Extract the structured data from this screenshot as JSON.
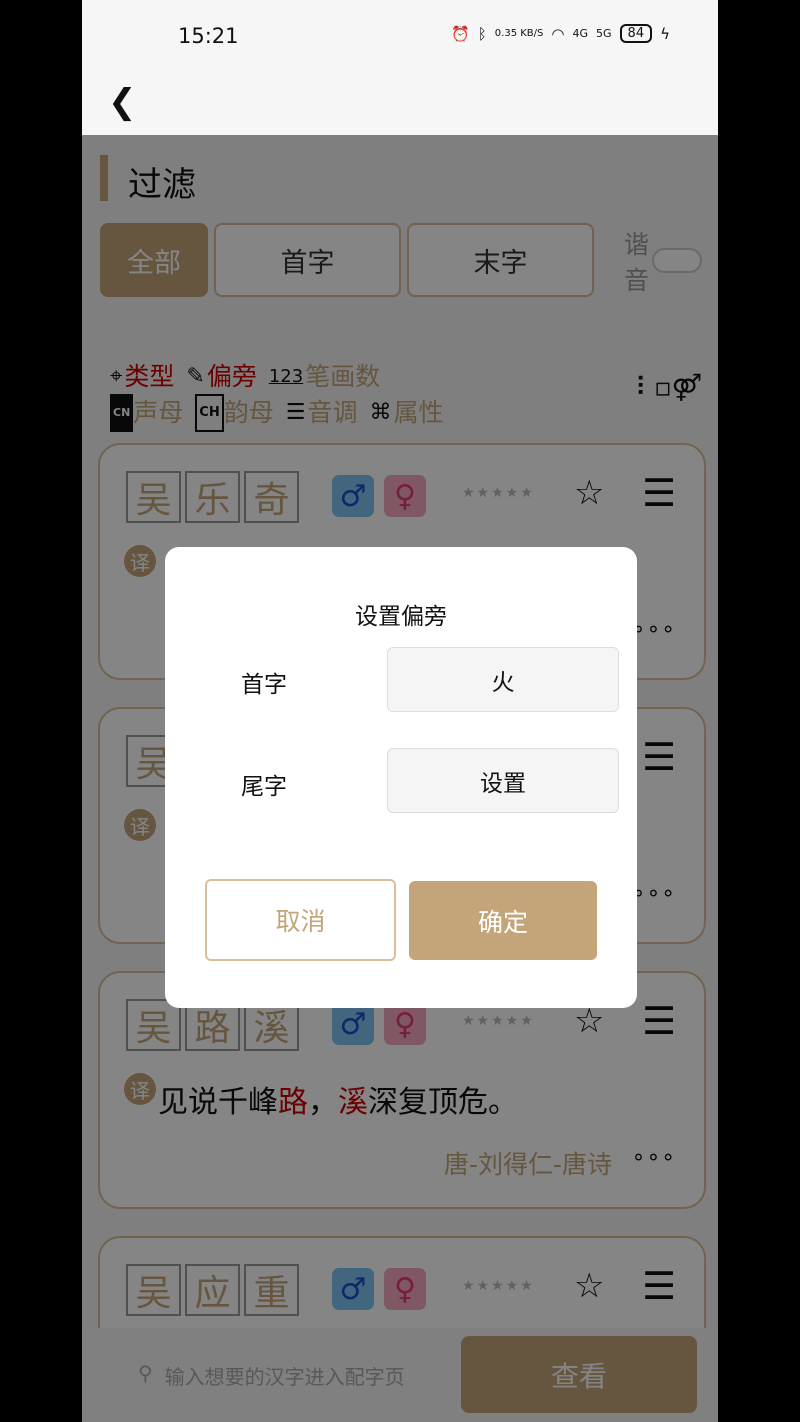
{
  "status": {
    "time": "15:21",
    "speed": "0.35 KB/S",
    "net1": "4G",
    "net2": "5G",
    "battery": "84"
  },
  "filter": {
    "title": "过滤",
    "tabs": [
      {
        "label": "全部",
        "active": true
      },
      {
        "label": "首字"
      },
      {
        "label": "末字"
      }
    ],
    "xieyin": "谐音",
    "xieyin_on": false,
    "row1": [
      "类型",
      "偏旁",
      "笔画数"
    ],
    "row2": [
      "声母",
      "韵母",
      "音调",
      "属性"
    ],
    "cn": "CN",
    "ch": "CH",
    "num": "123"
  },
  "cards": [
    {
      "name": [
        "吴",
        "乐",
        "奇"
      ]
    },
    {
      "name": [
        "吴",
        "",
        ""
      ]
    },
    {
      "name": [
        "吴",
        "路",
        "溪"
      ],
      "poem": [
        {
          "t": "见说千峰"
        },
        {
          "t": "路",
          "red": true
        },
        {
          "t": "，"
        },
        {
          "t": "溪",
          "red": true
        },
        {
          "t": "深复顶危。"
        }
      ],
      "source": "唐-刘得仁-唐诗"
    },
    {
      "name": [
        "吴",
        "应",
        "重"
      ]
    }
  ],
  "yi": "译",
  "bottom": {
    "placeholder": "输入想要的汉字进入配字页",
    "button": "查看"
  },
  "dialog": {
    "title": "设置偏旁",
    "first_label": "首字",
    "first_value": "火",
    "last_label": "尾字",
    "last_value": "设置",
    "cancel": "取消",
    "confirm": "确定"
  },
  "colors": {
    "accent": "#c4a57a",
    "red": "#cc0000"
  }
}
